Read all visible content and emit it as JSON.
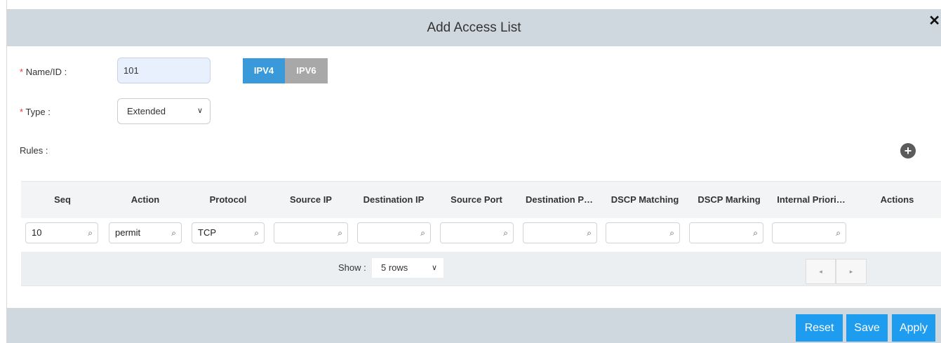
{
  "dialog": {
    "title": "Add Access List"
  },
  "form": {
    "name_label": "Name/ID :",
    "name_value": "101",
    "ip_versions": [
      "IPV4",
      "IPV6"
    ],
    "type_label": "Type :",
    "type_value": "Extended",
    "rules_label": "Rules :",
    "required_mark": "*"
  },
  "table": {
    "columns": [
      "Seq",
      "Action",
      "Protocol",
      "Source IP",
      "Destination IP",
      "Source Port",
      "Destination P…",
      "DSCP Matching",
      "DSCP Marking",
      "Internal Priori…",
      "Actions"
    ],
    "filters": [
      "10",
      "permit",
      "TCP",
      "",
      "",
      "",
      "",
      "",
      "",
      ""
    ],
    "pager": {
      "show_label": "Show :",
      "rows_value": "5 rows",
      "prev": "◂",
      "next": "▸"
    }
  },
  "footer": {
    "reset_label": "Reset",
    "save_label": "Save",
    "apply_label": "Apply"
  },
  "icons": {
    "close": "✖",
    "add": "+",
    "search": "🔍",
    "chevron": "⌄"
  },
  "colors": {
    "accent": "#1e9cf0",
    "ipv4_active": "#3a9ad9",
    "ipv6_inactive": "#a8a8a8",
    "header_bg": "#cfd8df"
  }
}
